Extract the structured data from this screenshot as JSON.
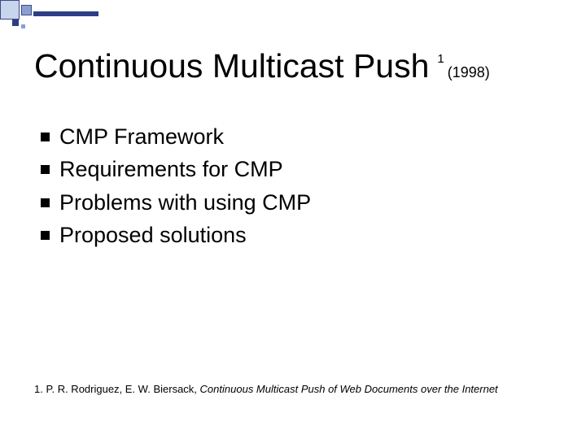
{
  "title": {
    "main": "Continuous Multicast Push",
    "ref_marker": "1",
    "year": "(1998)"
  },
  "bullets": [
    "CMP Framework",
    "Requirements for CMP",
    "Problems with using CMP",
    "Proposed solutions"
  ],
  "footnote": {
    "marker": "1.",
    "authors": "P. R. Rodriguez, E. W. Biersack,",
    "citation_title": "Continuous Multicast Push of Web Documents over the Internet"
  }
}
